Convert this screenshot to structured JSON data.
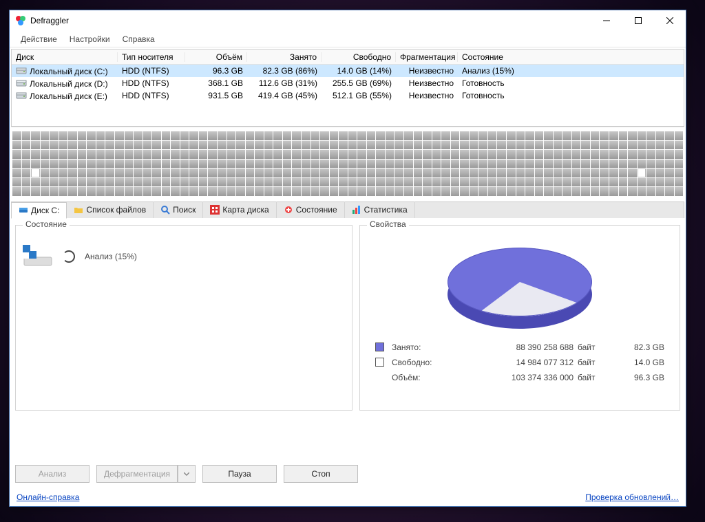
{
  "app": {
    "title": "Defraggler"
  },
  "menubar": {
    "action": "Действие",
    "settings": "Настройки",
    "help": "Справка"
  },
  "table": {
    "headers": {
      "disk": "Диск",
      "media": "Тип носителя",
      "size": "Объём",
      "used": "Занято",
      "free": "Свободно",
      "frag": "Фрагментация",
      "state": "Состояние"
    },
    "rows": [
      {
        "name": "Локальный диск (C:)",
        "media": "HDD (NTFS)",
        "size": "96.3 GB",
        "used": "82.3 GB (86%)",
        "free": "14.0 GB (14%)",
        "frag": "Неизвестно",
        "state": "Анализ (15%)",
        "selected": true
      },
      {
        "name": "Локальный диск (D:)",
        "media": "HDD (NTFS)",
        "size": "368.1 GB",
        "used": "112.6 GB (31%)",
        "free": "255.5 GB (69%)",
        "frag": "Неизвестно",
        "state": "Готовность",
        "selected": false
      },
      {
        "name": "Локальный диск (E:)",
        "media": "HDD (NTFS)",
        "size": "931.5 GB",
        "used": "419.4 GB (45%)",
        "free": "512.1 GB (55%)",
        "frag": "Неизвестно",
        "state": "Готовность",
        "selected": false
      }
    ]
  },
  "tabs": {
    "disk": "Диск C:",
    "files": "Список файлов",
    "search": "Поиск",
    "map": "Карта диска",
    "state": "Состояние",
    "stats": "Статистика"
  },
  "panels": {
    "state_title": "Состояние",
    "analysis_text": "Анализ (15%)",
    "props_title": "Свойства",
    "used_label": "Занято:",
    "free_label": "Свободно:",
    "size_label": "Объём:",
    "unit": "байт",
    "used_bytes": "88 390 258 688",
    "used_gb": "82.3 GB",
    "free_bytes": "14 984 077 312",
    "free_gb": "14.0 GB",
    "size_bytes": "103 374 336 000",
    "size_gb": "96.3 GB"
  },
  "buttons": {
    "analyze": "Анализ",
    "defrag": "Дефрагментация",
    "pause": "Пауза",
    "stop": "Стоп"
  },
  "links": {
    "help": "Онлайн-справка",
    "update": "Проверка обновлений…"
  },
  "chart_data": {
    "type": "pie",
    "title": "Свойства",
    "series": [
      {
        "name": "Занято",
        "value_bytes": 88390258688,
        "value_gb": 82.3,
        "percent": 86,
        "color": "#7070db"
      },
      {
        "name": "Свободно",
        "value_bytes": 14984077312,
        "value_gb": 14.0,
        "percent": 14,
        "color": "#ffffff"
      }
    ],
    "total": {
      "name": "Объём",
      "value_bytes": 103374336000,
      "value_gb": 96.3
    }
  },
  "fragmap": {
    "cols": 72,
    "rows": 7,
    "white_cells": [
      290,
      355
    ]
  }
}
